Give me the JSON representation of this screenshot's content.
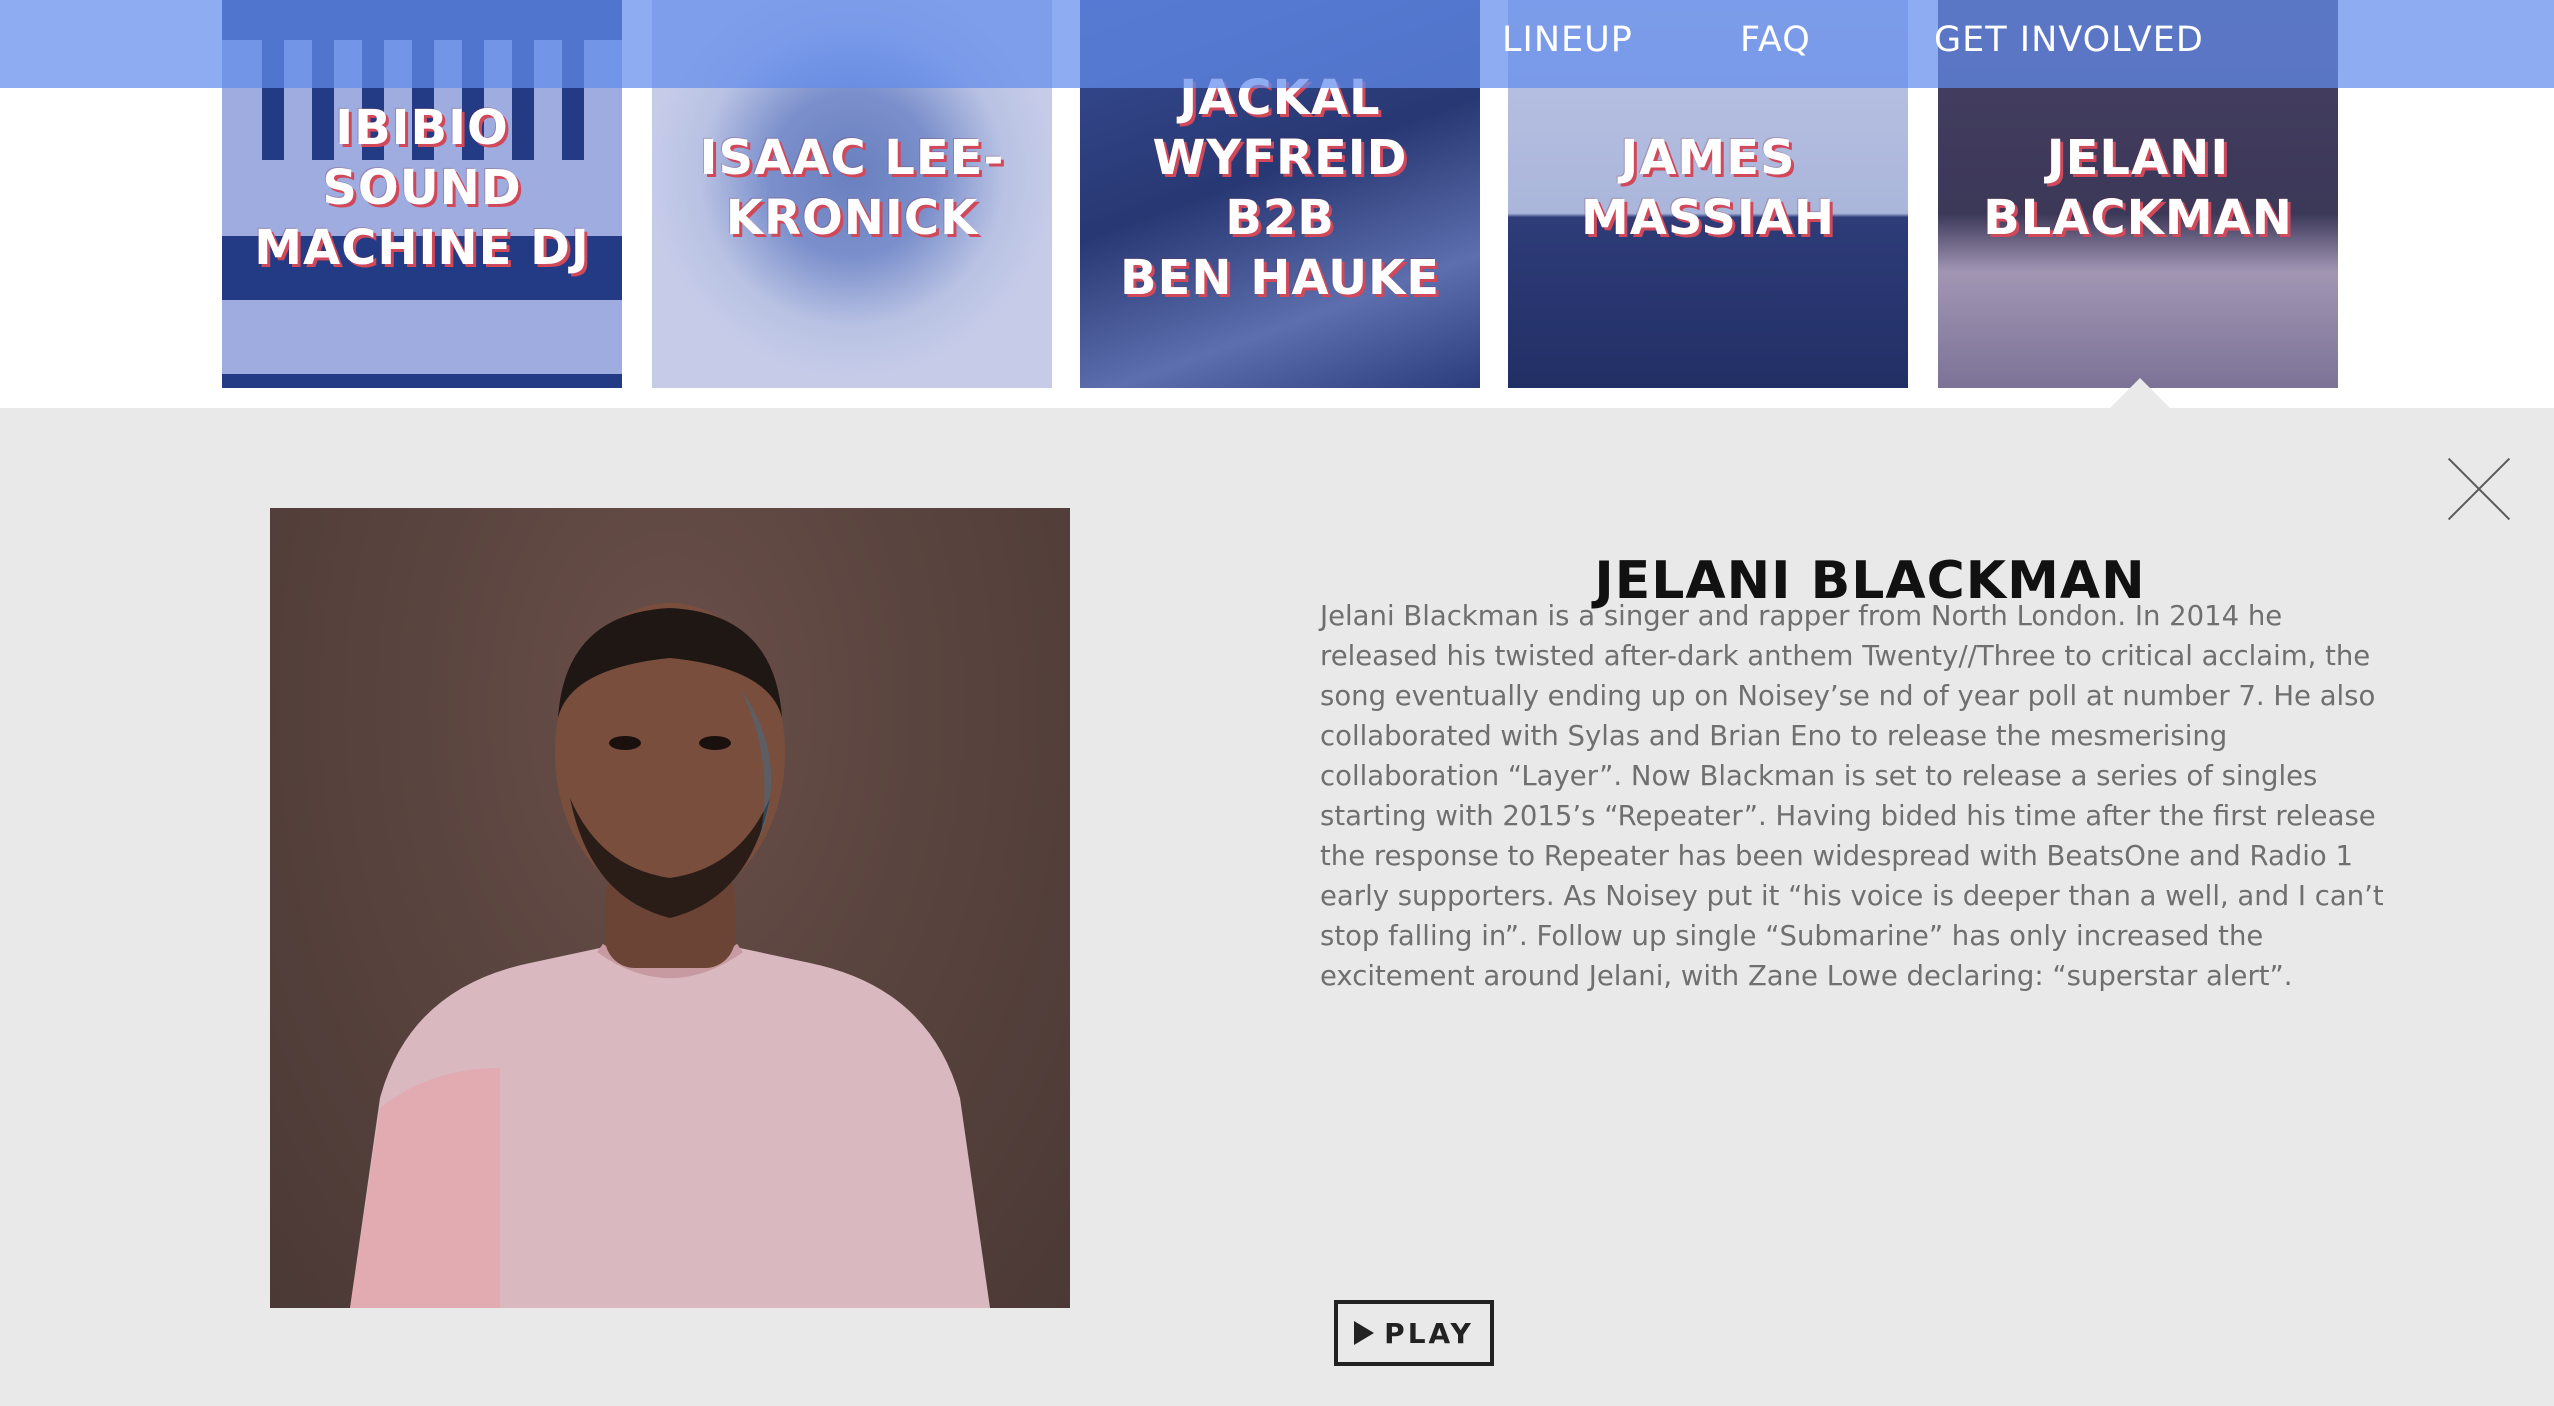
{
  "nav": {
    "lineup": "LINEUP",
    "faq": "FAQ",
    "get_involved": "GET INVOLVED"
  },
  "tiles": [
    {
      "name": "IBIBIO SOUND\nMACHINE DJ"
    },
    {
      "name": "ISAAC LEE-\nKRONICK"
    },
    {
      "name": "JACKAL\nWYFREID B2B\nBEN HAUKE"
    },
    {
      "name": "JAMES\nMASSIAH"
    },
    {
      "name": "JELANI\nBLACKMAN"
    }
  ],
  "detail": {
    "name": "JELANI BLACKMAN",
    "bio": "Jelani Blackman is a singer and rapper from North London. In 2014 he released his twisted after-dark anthem Twenty//Three to critical acclaim, the song eventually ending up on Noisey’se nd of year poll at number 7. He also collaborated with Sylas and Brian Eno to release the mesmerising collaboration “Layer”. Now Blackman is set to release a series of singles starting with 2015’s “Repeater”. Having bided his time after the first release the response to Repeater has been widespread with BeatsOne and Radio 1 early supporters. As Noisey put it “his voice is deeper than a well, and I can’t stop falling in”. Follow up single “Submarine” has only increased the excitement around Jelani, with Zane Lowe declaring: “superstar alert”.",
    "play_label": "PLAY",
    "close_icon": "close-icon",
    "play_icon": "play-icon"
  },
  "colors": {
    "nav_bar": "#628cec",
    "tile_tint": "#304ebe",
    "tile_text_shadow": "#d0485a",
    "panel_bg": "#e9e9ea",
    "bio_text": "#6f6f6f"
  }
}
